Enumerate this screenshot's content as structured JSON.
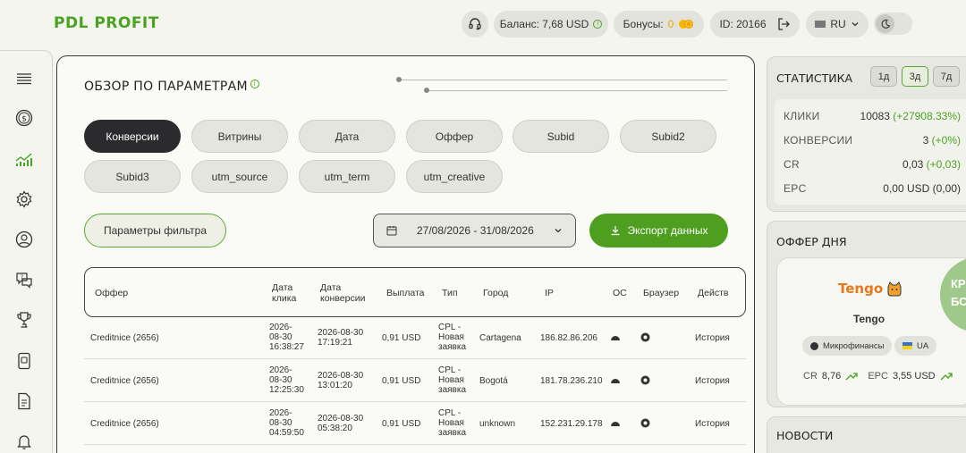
{
  "header": {
    "logo": "PDL PROFIT",
    "balance": "Баланс: 7,68 USD",
    "bonus_label": "Бонусы:",
    "bonus_value": "0",
    "user_id": "ID: 20166",
    "lang": "RU"
  },
  "main": {
    "title": "ОБЗОР ПО ПАРАМЕТРАМ",
    "chips": [
      "Конверсии",
      "Витрины",
      "Дата",
      "Оффер",
      "Subid",
      "Subid2",
      "Subid3",
      "utm_source",
      "utm_term",
      "utm_creative"
    ],
    "filter_button": "Параметры фильтра",
    "date_range": "27/08/2026 - 31/08/2026",
    "export_button": "Экспорт данных",
    "table": {
      "headers": [
        "Оффер",
        "Дата клика",
        "Дата конверсии",
        "Выплата",
        "Тип",
        "Город",
        "IP",
        "ОС",
        "Браузер",
        "Действ"
      ],
      "rows": [
        {
          "offer": "Creditnice (2656)",
          "click_date": "2026-08-30 16:38:27",
          "conv_date": "2026-08-30 17:19:21",
          "payout": "0,91 USD",
          "type": "CPL - Новая заявка",
          "city": "Cartagena",
          "ip": "186.82.86.206",
          "action": "История"
        },
        {
          "offer": "Creditnice (2656)",
          "click_date": "2026-08-30 12:25:30",
          "conv_date": "2026-08-30 13:01:20",
          "payout": "0,91 USD",
          "type": "CPL - Новая заявка",
          "city": "Bogotá",
          "ip": "181.78.236.210",
          "action": "История"
        },
        {
          "offer": "Creditnice (2656)",
          "click_date": "2026-08-30 04:59:50",
          "conv_date": "2026-08-30 05:38:20",
          "payout": "0,91 USD",
          "type": "CPL - Новая заявка",
          "city": "unknown",
          "ip": "152.231.29.178",
          "action": "История"
        }
      ]
    }
  },
  "stats": {
    "title": "СТАТИСТИКА",
    "ranges": [
      "1д",
      "3д",
      "7д"
    ],
    "active_range": "3д",
    "rows": [
      {
        "label": "КЛИКИ",
        "value": "10083",
        "delta": "(+27908.33%)"
      },
      {
        "label": "КОНВЕРСИИ",
        "value": "3",
        "delta": "(+0%)"
      },
      {
        "label": "CR",
        "value": "0,03",
        "delta": "(+0,03)"
      },
      {
        "label": "EPC",
        "value": "0,00 USD",
        "delta": "(0,00)"
      }
    ]
  },
  "offer_of_day": {
    "title": "ОФФЕР ДНЯ",
    "brand": "Tengo",
    "name": "Tengo",
    "category": "Микрофинансы",
    "country": "UA",
    "cr_label": "CR",
    "cr_value": "8,76",
    "epc_label": "EPC",
    "epc_value": "3,55 USD",
    "badge_line1": "КР",
    "badge_line2": "БС"
  },
  "news": {
    "title": "НОВОСТИ"
  },
  "colors": {
    "accent": "#4aa221",
    "export": "#4e9e1f",
    "active_chip": "#2b2b2e"
  }
}
